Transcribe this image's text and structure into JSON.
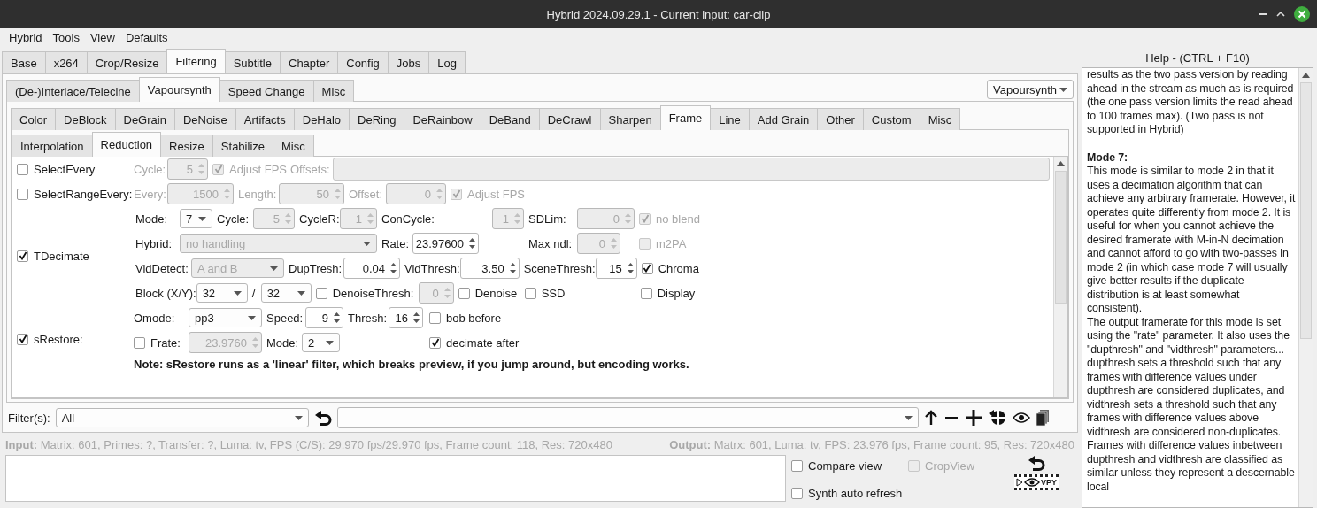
{
  "window": {
    "title": "Hybrid 2024.09.29.1 - Current input: car-clip"
  },
  "menu": [
    "Hybrid",
    "Tools",
    "View",
    "Defaults"
  ],
  "main_tabs": [
    {
      "label": "Base",
      "selected": false
    },
    {
      "label": "x264",
      "selected": false
    },
    {
      "label": "Crop/Resize",
      "selected": false
    },
    {
      "label": "Filtering",
      "selected": true
    },
    {
      "label": "Subtitle",
      "selected": false
    },
    {
      "label": "Chapter",
      "selected": false
    },
    {
      "label": "Config",
      "selected": false
    },
    {
      "label": "Jobs",
      "selected": false
    },
    {
      "label": "Log",
      "selected": false
    }
  ],
  "filter_tabs": [
    {
      "label": "(De-)Interlace/Telecine",
      "selected": false
    },
    {
      "label": "Vapoursynth",
      "selected": true
    },
    {
      "label": "Speed Change",
      "selected": false
    },
    {
      "label": "Misc",
      "selected": false
    }
  ],
  "engine_combo": "Vapoursynth",
  "vs_tabs": [
    {
      "label": "Color",
      "selected": false
    },
    {
      "label": "DeBlock",
      "selected": false
    },
    {
      "label": "DeGrain",
      "selected": false
    },
    {
      "label": "DeNoise",
      "selected": false
    },
    {
      "label": "Artifacts",
      "selected": false
    },
    {
      "label": "DeHalo",
      "selected": false
    },
    {
      "label": "DeRing",
      "selected": false
    },
    {
      "label": "DeRainbow",
      "selected": false
    },
    {
      "label": "DeBand",
      "selected": false
    },
    {
      "label": "DeCrawl",
      "selected": false
    },
    {
      "label": "Sharpen",
      "selected": false
    },
    {
      "label": "Frame",
      "selected": true
    },
    {
      "label": "Line",
      "selected": false
    },
    {
      "label": "Add Grain",
      "selected": false
    },
    {
      "label": "Other",
      "selected": false
    },
    {
      "label": "Custom",
      "selected": false
    },
    {
      "label": "Misc",
      "selected": false
    }
  ],
  "frame_tabs": [
    {
      "label": "Interpolation",
      "selected": false
    },
    {
      "label": "Reduction",
      "selected": true
    },
    {
      "label": "Resize",
      "selected": false
    },
    {
      "label": "Stabilize",
      "selected": false
    },
    {
      "label": "Misc",
      "selected": false
    }
  ],
  "sections": [
    {
      "label": "SelectEvery",
      "checked": false,
      "lines": [
        {
          "items": [
            {
              "kind": "label",
              "text": "Cycle:",
              "disabled": true
            },
            {
              "kind": "spin",
              "value": "5",
              "disabled": true
            },
            {
              "kind": "check",
              "label": "Adjust FPS",
              "checked": true,
              "disabled": true
            },
            {
              "kind": "label",
              "text": "Offsets:",
              "disabled": true
            },
            {
              "kind": "field",
              "disabled": true
            }
          ]
        }
      ]
    },
    {
      "label": "SelectRangeEvery:",
      "checked": false,
      "lines": [
        {
          "items": [
            {
              "kind": "label",
              "text": "Every:",
              "disabled": true
            },
            {
              "kind": "spin",
              "value": "1500",
              "disabled": true
            },
            {
              "kind": "label",
              "text": "Length:",
              "disabled": true
            },
            {
              "kind": "spin",
              "value": "50",
              "disabled": true
            },
            {
              "kind": "label",
              "text": "Offset:",
              "disabled": true
            },
            {
              "kind": "spin",
              "value": "0",
              "disabled": true
            },
            {
              "kind": "check",
              "label": "Adjust FPS",
              "checked": true,
              "disabled": true
            }
          ]
        }
      ]
    },
    {
      "label": "TDecimate",
      "checked": true,
      "lines": [
        {
          "items": [
            {
              "kind": "label",
              "text": "Mode:",
              "disabled": false
            },
            {
              "kind": "combo",
              "value": "7",
              "disabled": false
            },
            {
              "kind": "label",
              "text": "Cycle:",
              "disabled": false
            },
            {
              "kind": "spin",
              "value": "5",
              "disabled": true
            },
            {
              "kind": "label",
              "text": "CycleR:",
              "disabled": false
            },
            {
              "kind": "spin",
              "value": "1",
              "disabled": true
            },
            {
              "kind": "label",
              "text": "ConCycle:",
              "disabled": false
            },
            {
              "kind": "spin",
              "value": "1",
              "disabled": true
            },
            {
              "kind": "label",
              "text": "SDLim:",
              "disabled": false
            },
            {
              "kind": "spin",
              "value": "0",
              "disabled": true
            },
            {
              "kind": "check",
              "label": "no blend",
              "checked": true,
              "disabled": true
            }
          ]
        },
        {
          "items": [
            {
              "kind": "label",
              "text": "Hybrid:",
              "disabled": false
            },
            {
              "kind": "combo",
              "value": "no handling",
              "disabled": true
            },
            {
              "kind": "label",
              "text": "Rate:",
              "disabled": false
            },
            {
              "kind": "spin",
              "value": "23.97600",
              "disabled": false
            },
            {
              "kind": "label",
              "text": "Max ndl:",
              "disabled": false
            },
            {
              "kind": "spin",
              "value": "0",
              "disabled": true
            },
            {
              "kind": "check",
              "label": "m2PA",
              "checked": false,
              "disabled": true
            }
          ]
        },
        {
          "items": [
            {
              "kind": "label",
              "text": "VidDetect:",
              "disabled": false
            },
            {
              "kind": "combo",
              "value": "A and B",
              "disabled": true
            },
            {
              "kind": "label",
              "text": "DupTresh:",
              "disabled": false
            },
            {
              "kind": "spin",
              "value": "0.04",
              "disabled": false
            },
            {
              "kind": "label",
              "text": "VidThresh:",
              "disabled": false
            },
            {
              "kind": "spin",
              "value": "3.50",
              "disabled": false
            },
            {
              "kind": "label",
              "text": "SceneThresh:",
              "disabled": false
            },
            {
              "kind": "spin",
              "value": "15",
              "disabled": false
            },
            {
              "kind": "check",
              "label": "Chroma",
              "checked": true,
              "disabled": false
            }
          ]
        },
        {
          "items": [
            {
              "kind": "label",
              "text": "Block (X/Y):",
              "disabled": false
            },
            {
              "kind": "combo",
              "value": "32",
              "disabled": false
            },
            {
              "kind": "label",
              "text": "/",
              "disabled": false
            },
            {
              "kind": "combo",
              "value": "32",
              "disabled": false
            },
            {
              "kind": "check",
              "label": "DenoiseThresh:",
              "checked": false,
              "disabled": false
            },
            {
              "kind": "spin",
              "value": "0",
              "disabled": true
            },
            {
              "kind": "check",
              "label": "Denoise",
              "checked": false,
              "disabled": false
            },
            {
              "kind": "check",
              "label": "SSD",
              "checked": false,
              "disabled": false
            },
            {
              "kind": "check",
              "label": "Display",
              "checked": false,
              "disabled": false
            }
          ]
        }
      ]
    },
    {
      "label": "sRestore:",
      "checked": true,
      "lines": [
        {
          "items": [
            {
              "kind": "label",
              "text": "Omode:",
              "disabled": false
            },
            {
              "kind": "combo",
              "value": "pp3",
              "disabled": false
            },
            {
              "kind": "label",
              "text": "Speed:",
              "disabled": false
            },
            {
              "kind": "spin",
              "value": "9",
              "disabled": false
            },
            {
              "kind": "label",
              "text": "Thresh:",
              "disabled": false
            },
            {
              "kind": "spin",
              "value": "16",
              "disabled": false
            },
            {
              "kind": "check",
              "label": "bob before",
              "checked": false,
              "disabled": false
            }
          ]
        },
        {
          "items": [
            {
              "kind": "check",
              "label": "Frate:",
              "checked": false,
              "disabled": false
            },
            {
              "kind": "spin",
              "value": "23.9760",
              "disabled": true
            },
            {
              "kind": "label",
              "text": "Mode:",
              "disabled": false
            },
            {
              "kind": "combo",
              "value": "2",
              "disabled": false
            },
            {
              "kind": "check",
              "label": "decimate after",
              "checked": true,
              "disabled": false
            }
          ]
        }
      ],
      "note": "Note: sRestore runs as a 'linear' filter, which breaks preview, if you jump around, but encoding works."
    }
  ],
  "filter_bar": {
    "label": "Filter(s):",
    "combo": "All"
  },
  "input_info": "**Input:** Matrix: 601, Primes: ?, Transfer: ?, Luma: tv, FPS (C/S): 29.970 fps/29.970 fps, Frame count: 118, Res: 720x480",
  "output_info": "**Output:** Matrx: 601, Luma: tv, FPS: 23.976 fps, Frame count: 95, Res: 720x480",
  "bottom_checks": [
    {
      "label": "Compare view",
      "checked": false,
      "disabled": false
    },
    {
      "label": "CropView",
      "checked": false,
      "disabled": true
    },
    {
      "label": "Synth auto refresh",
      "checked": false,
      "disabled": false
    }
  ],
  "preview_label": "VPY",
  "help": {
    "title": "Help - (CTRL + F10)",
    "paragraphs": [
      {
        "kind": "text",
        "text": "results as the two pass version by reading ahead in the stream as much as is required  (the one pass version limits the read ahead to 100 frames max). (Two pass is not supported in Hybrid)"
      },
      {
        "kind": "heading",
        "text": "Mode 7:"
      },
      {
        "kind": "text",
        "text": "This mode is similar to mode 2 in that it uses a decimation algorithm that can achieve any arbitrary framerate. However, it operates quite differently from mode 2.  It is useful for when you cannot achieve the desired framerate with M-in-N decimation and cannot afford to go with two-passes in mode 2 (in which case mode 7 will usually give better results if the duplicate distribution is at least somewhat consistent)."
      },
      {
        "kind": "text",
        "text": "The output framerate for this mode is set using the \"rate\" parameter. It also uses the \"dupthresh\" and \"vidthresh\" parameters... dupthresh sets a threshold such that any frames with difference values under dupthresh are considered duplicates, and vidthresh sets a threshold such that any frames with difference values above vidthresh are considered non-duplicates. Frames with difference values inbetween dupthresh and vidthresh are classified as similar unless they represent a descernable local"
      }
    ]
  }
}
